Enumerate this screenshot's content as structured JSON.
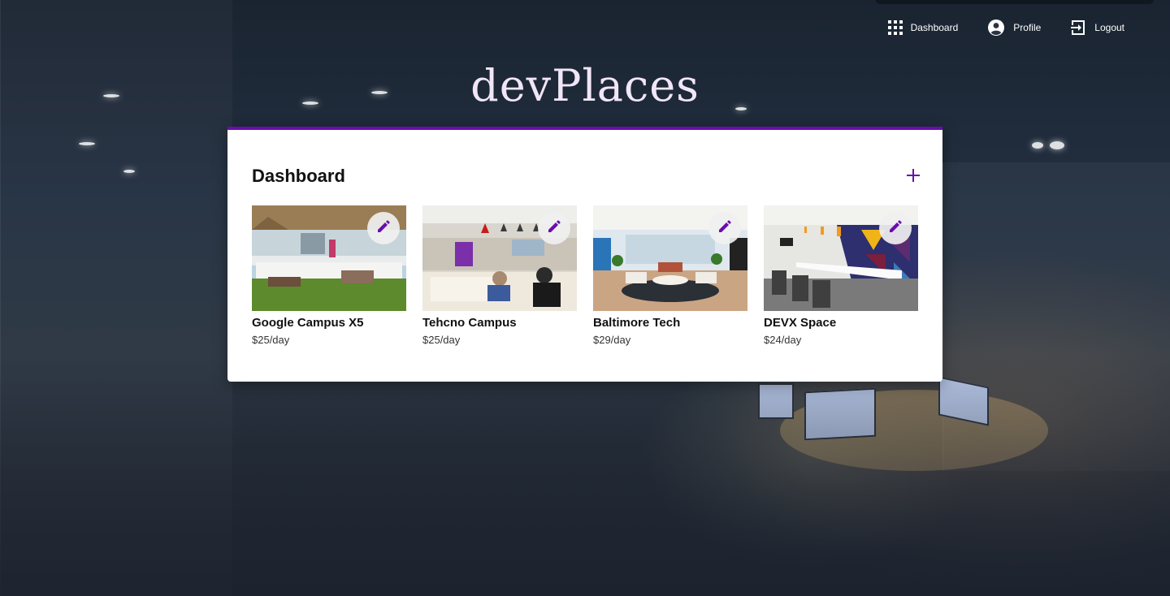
{
  "nav": {
    "dashboard_label": "Dashboard",
    "profile_label": "Profile",
    "logout_label": "Logout",
    "dashboard_icon": "apps-grid-icon",
    "profile_icon": "account-circle-icon",
    "logout_icon": "exit-to-app-icon"
  },
  "brand": {
    "title": "devPlaces"
  },
  "dashboard": {
    "title": "Dashboard",
    "add_icon": "plus-icon",
    "accent_color": "#6a0dad",
    "places": [
      {
        "name": "Google Campus X5",
        "price": "$25/day",
        "photo": "rooftop lounge with white sofas"
      },
      {
        "name": "Tehcno Campus",
        "price": "$25/day",
        "photo": "open cafe workspace with pendant lights"
      },
      {
        "name": "Baltimore Tech",
        "price": "$29/day",
        "photo": "bright lounge with round coffee table"
      },
      {
        "name": "DEVX Space",
        "price": "$24/day",
        "photo": "long conference table with geometric wall"
      }
    ]
  }
}
